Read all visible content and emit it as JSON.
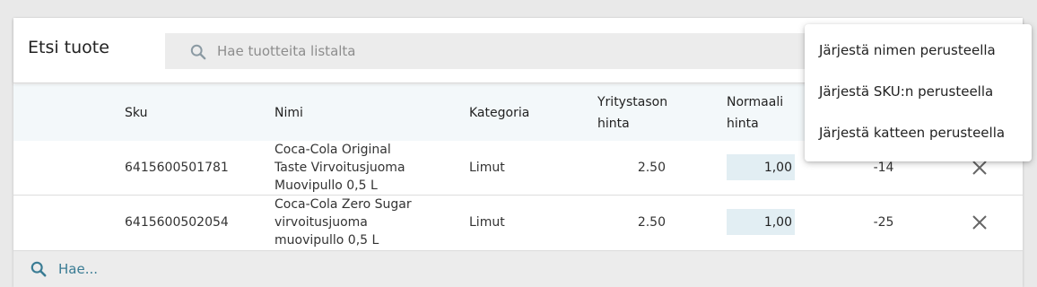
{
  "header": {
    "title": "Etsi tuote",
    "search_placeholder": "Hae tuotteita listalta"
  },
  "table": {
    "columns": [
      "Sku",
      "Nimi",
      "Kategoria",
      "Yritystason hinta",
      "Normaali hinta"
    ],
    "rows": [
      {
        "sku": "6415600501781",
        "name_lines": [
          "Coca-Cola Original",
          "Taste Virvoitusjuoma",
          "Muovipullo 0,5 L"
        ],
        "category": "Limut",
        "company_price": "2.50",
        "normal_price": "1,00",
        "margin": "-14"
      },
      {
        "sku": "6415600502054",
        "name_lines": [
          "Coca-Cola Zero Sugar",
          "virvoitusjuoma",
          "muovipullo 0,5 L"
        ],
        "category": "Limut",
        "company_price": "2.50",
        "normal_price": "1,00",
        "margin": "-25"
      }
    ]
  },
  "footer": {
    "search_placeholder": "Hae..."
  },
  "sort_menu": {
    "items": [
      "Järjestä nimen perusteella",
      "Järjestä SKU:n perusteella",
      "Järjestä katteen perusteella"
    ]
  },
  "colors": {
    "header_row_bg": "#f3f8fa",
    "price_input_bg": "#e2eef3",
    "accent": "#3a7c94"
  },
  "icons": {
    "search": "search-icon",
    "delete": "close-icon"
  }
}
